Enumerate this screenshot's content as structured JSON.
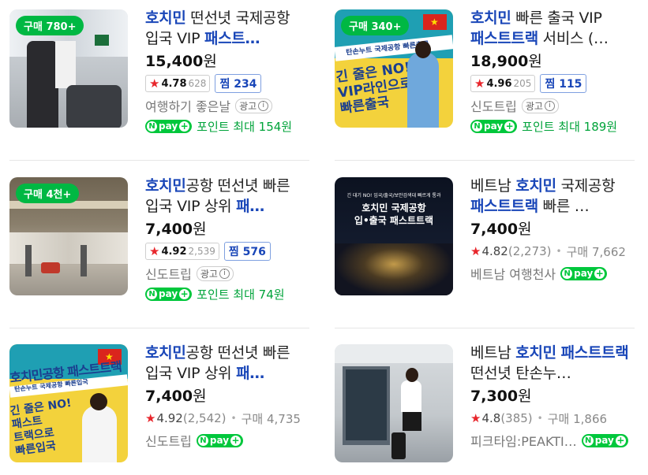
{
  "products": [
    {
      "badge": "구매 780+",
      "title_parts": [
        {
          "t": "호치민",
          "kw": true
        },
        {
          "t": " 떤선녓 국제공항 입국 VIP ",
          "kw": false
        },
        {
          "t": "패스트…",
          "kw": true
        }
      ],
      "price": "15,400",
      "won": "원",
      "rating": "4.78",
      "review_count": "628",
      "zzim_label": "찜",
      "zzim_count": "234",
      "seller": "여행하기 좋은날",
      "ad_label": "광고",
      "point_text": "포인트 최대 154원"
    },
    {
      "badge": "구매 340+",
      "title_parts": [
        {
          "t": "호치민",
          "kw": true
        },
        {
          "t": " 빠른 출국 VIP ",
          "kw": false
        },
        {
          "t": "패스트트랙",
          "kw": true
        },
        {
          "t": " 서비스 (…",
          "kw": false
        }
      ],
      "price": "18,900",
      "won": "원",
      "rating": "4.96",
      "review_count": "205",
      "zzim_label": "찜",
      "zzim_count": "115",
      "seller": "신도트립",
      "ad_label": "광고",
      "point_text": "포인트 최대 189원",
      "image_texts": [
        "탄손누트 국제공항 빠른출국",
        "긴 줄은 NO!",
        "VIP라인으로",
        "빠른출국"
      ]
    },
    {
      "badge": "구매 4천+",
      "title_parts": [
        {
          "t": "호치민",
          "kw": true
        },
        {
          "t": "공항 떤선녓 빠른 입국 VIP 상위 ",
          "kw": false
        },
        {
          "t": "패…",
          "kw": true
        }
      ],
      "price": "7,400",
      "won": "원",
      "rating": "4.92",
      "review_count": "2,539",
      "zzim_label": "찜",
      "zzim_count": "576",
      "seller": "신도트립",
      "ad_label": "광고",
      "point_text": "포인트 최대 74원"
    },
    {
      "title_parts": [
        {
          "t": "베트남 ",
          "kw": false
        },
        {
          "t": "호치민",
          "kw": true
        },
        {
          "t": " 국제공항 ",
          "kw": false
        },
        {
          "t": "패스트트랙",
          "kw": true
        },
        {
          "t": " 빠른 …",
          "kw": false
        }
      ],
      "price": "7,400",
      "won": "원",
      "rating": "4.82",
      "review_count": "(2,273)",
      "buy_text": "구매 7,662",
      "seller": "베트남 여행천사",
      "image_texts": [
        "긴 대기 NO! 입국/출국/보안검색대 빠르게 통과",
        "호치민 국제공항",
        "입•출국 패스트트랙"
      ]
    },
    {
      "title_parts": [
        {
          "t": "호치민",
          "kw": true
        },
        {
          "t": "공항 떤선녓 빠른 입국 VIP 상위 ",
          "kw": false
        },
        {
          "t": "패…",
          "kw": true
        }
      ],
      "price": "7,400",
      "won": "원",
      "rating": "4.92",
      "review_count": "(2,542)",
      "buy_text": "구매 4,735",
      "seller": "신도트립",
      "image_texts": [
        "호치민공항 패스트트랙",
        "탄손누트 국제공항 빠른입국",
        "긴 줄은 NO!",
        "패스트",
        "트랙으로",
        "빠른입국"
      ]
    },
    {
      "title_parts": [
        {
          "t": "베트남 ",
          "kw": false
        },
        {
          "t": "호치민",
          "kw": true
        },
        {
          "t": " ",
          "kw": false
        },
        {
          "t": "패스트트랙",
          "kw": true
        },
        {
          "t": " 떤선녓 탄손누…",
          "kw": false
        }
      ],
      "price": "7,300",
      "won": "원",
      "rating": "4.8",
      "review_count": "(385)",
      "buy_text": "구매 1,866",
      "seller": "피크타임:PEAKTI…"
    }
  ],
  "npay_label": "pay",
  "colors": {
    "keyword": "#1946b8",
    "badge": "#00b843",
    "npay": "#00c73c",
    "star": "#e8262c",
    "point": "#00a33a"
  }
}
